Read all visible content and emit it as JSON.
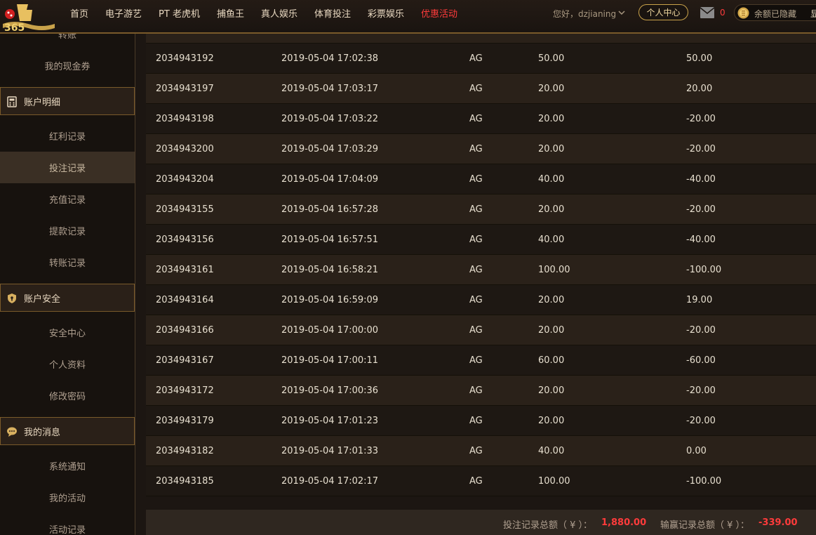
{
  "nav": [
    "首页",
    "电子游艺",
    "PT 老虎机",
    "捕鱼王",
    "真人娱乐",
    "体育投注",
    "彩票娱乐",
    "优惠活动"
  ],
  "header": {
    "greeting": "您好，dzjianing",
    "center_button": "个人中心",
    "mail_count": "0",
    "balance_hidden": "余额已隐藏",
    "balance_show": "显"
  },
  "sidebar": {
    "cut_item": "转账",
    "cash_coupon": "我的现金券",
    "account_detail": "账户明细",
    "bonus_record": "红利记录",
    "bet_record": "投注记录",
    "deposit_record": "充值记录",
    "withdraw_record": "提款记录",
    "transfer_record": "转账记录",
    "account_security": "账户安全",
    "security_center": "安全中心",
    "personal_info": "个人资料",
    "change_password": "修改密码",
    "my_messages": "我的消息",
    "system_notice": "系统通知",
    "my_activity": "我的活动",
    "activity_record": "活动记录"
  },
  "table": {
    "rows": [
      [
        "2034943192",
        "2019-05-04 17:02:38",
        "AG",
        "50.00",
        "50.00"
      ],
      [
        "2034943197",
        "2019-05-04 17:03:17",
        "AG",
        "20.00",
        "20.00"
      ],
      [
        "2034943198",
        "2019-05-04 17:03:22",
        "AG",
        "20.00",
        "-20.00"
      ],
      [
        "2034943200",
        "2019-05-04 17:03:29",
        "AG",
        "20.00",
        "-20.00"
      ],
      [
        "2034943204",
        "2019-05-04 17:04:09",
        "AG",
        "40.00",
        "-40.00"
      ],
      [
        "2034943155",
        "2019-05-04 16:57:28",
        "AG",
        "20.00",
        "-20.00"
      ],
      [
        "2034943156",
        "2019-05-04 16:57:51",
        "AG",
        "40.00",
        "-40.00"
      ],
      [
        "2034943161",
        "2019-05-04 16:58:21",
        "AG",
        "100.00",
        "-100.00"
      ],
      [
        "2034943164",
        "2019-05-04 16:59:09",
        "AG",
        "20.00",
        "19.00"
      ],
      [
        "2034943166",
        "2019-05-04 17:00:00",
        "AG",
        "20.00",
        "-20.00"
      ],
      [
        "2034943167",
        "2019-05-04 17:00:11",
        "AG",
        "60.00",
        "-60.00"
      ],
      [
        "2034943172",
        "2019-05-04 17:00:36",
        "AG",
        "20.00",
        "-20.00"
      ],
      [
        "2034943179",
        "2019-05-04 17:01:23",
        "AG",
        "20.00",
        "-20.00"
      ],
      [
        "2034943182",
        "2019-05-04 17:01:33",
        "AG",
        "40.00",
        "0.00"
      ],
      [
        "2034943185",
        "2019-05-04 17:02:17",
        "AG",
        "100.00",
        "-100.00"
      ]
    ]
  },
  "summary": {
    "bet_total_label": "投注记录总额（ ¥ ）：",
    "bet_total_value": "1,880.00",
    "winloss_total_label": "输赢记录总额（ ¥ ）：",
    "winloss_total_value": "-339.00"
  },
  "icons": {
    "logo": "bo-365-logo",
    "mail": "envelope-icon",
    "coin": "gold-coin-icon",
    "calculator": "calculator-icon",
    "shield": "shield-icon",
    "chat": "chat-bubble-icon"
  }
}
